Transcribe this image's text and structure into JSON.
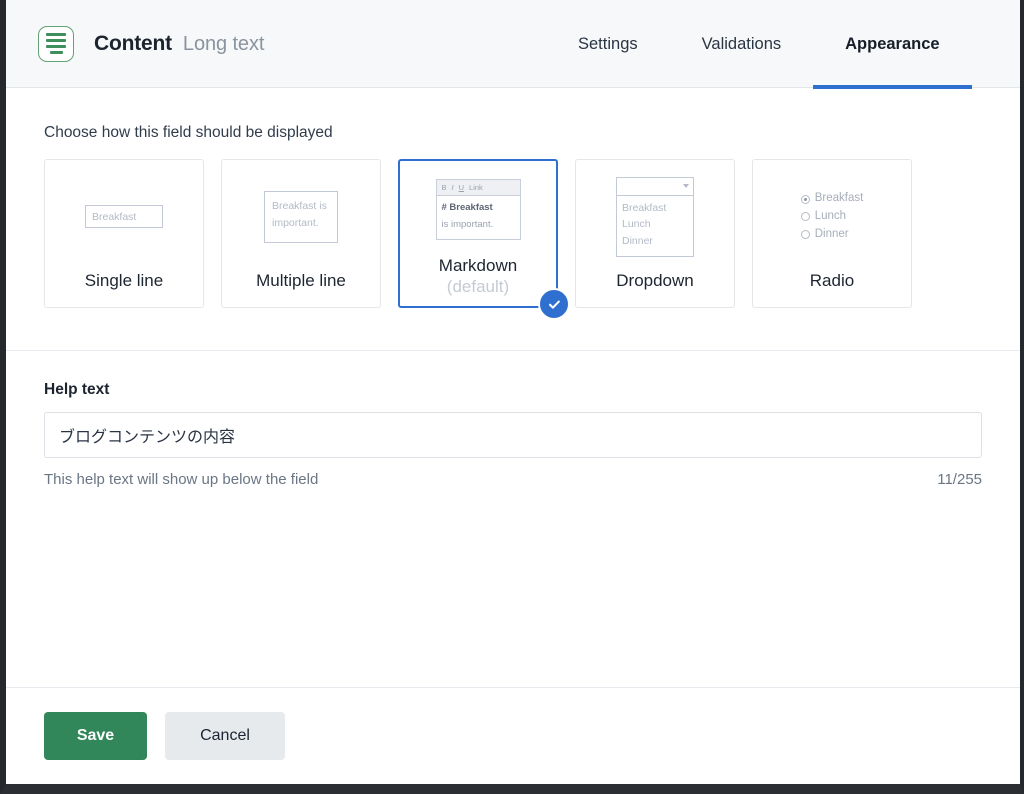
{
  "header": {
    "icon": "long-text-field-icon",
    "title": "Content",
    "subtitle": "Long text",
    "tabs": [
      {
        "label": "Settings",
        "active": false
      },
      {
        "label": "Validations",
        "active": false
      },
      {
        "label": "Appearance",
        "active": true
      }
    ],
    "accent_color": "#2f6fd0",
    "icon_color": "#3f8f5c"
  },
  "appearance": {
    "section_label": "Choose how this field should be displayed",
    "options": [
      {
        "id": "single-line",
        "label": "Single line",
        "selected": false,
        "preview": {
          "kind": "input",
          "text": "Breakfast"
        }
      },
      {
        "id": "multiple-line",
        "label": "Multiple line",
        "selected": false,
        "preview": {
          "kind": "textarea",
          "line1": "Breakfast is",
          "line2": "important."
        }
      },
      {
        "id": "markdown",
        "label": "Markdown",
        "default_tag": "(default)",
        "selected": true,
        "preview": {
          "kind": "markdown",
          "toolbar": [
            "B",
            "I",
            "U",
            "Link"
          ],
          "heading": "# Breakfast",
          "body": "is important."
        }
      },
      {
        "id": "dropdown",
        "label": "Dropdown",
        "selected": false,
        "preview": {
          "kind": "select",
          "value": "",
          "options": [
            "Breakfast",
            "Lunch",
            "Dinner"
          ]
        }
      },
      {
        "id": "radio",
        "label": "Radio",
        "selected": false,
        "preview": {
          "kind": "radio",
          "options": [
            {
              "label": "Breakfast",
              "checked": true
            },
            {
              "label": "Lunch",
              "checked": false
            },
            {
              "label": "Dinner",
              "checked": false
            }
          ]
        }
      }
    ]
  },
  "help": {
    "label": "Help text",
    "value": "ブログコンテンツの内容",
    "placeholder": "",
    "hint": "This help text will show up below the field",
    "counter": "11/255"
  },
  "footer": {
    "save_label": "Save",
    "cancel_label": "Cancel",
    "save_color": "#31875a",
    "cancel_color": "#e6eaed"
  }
}
